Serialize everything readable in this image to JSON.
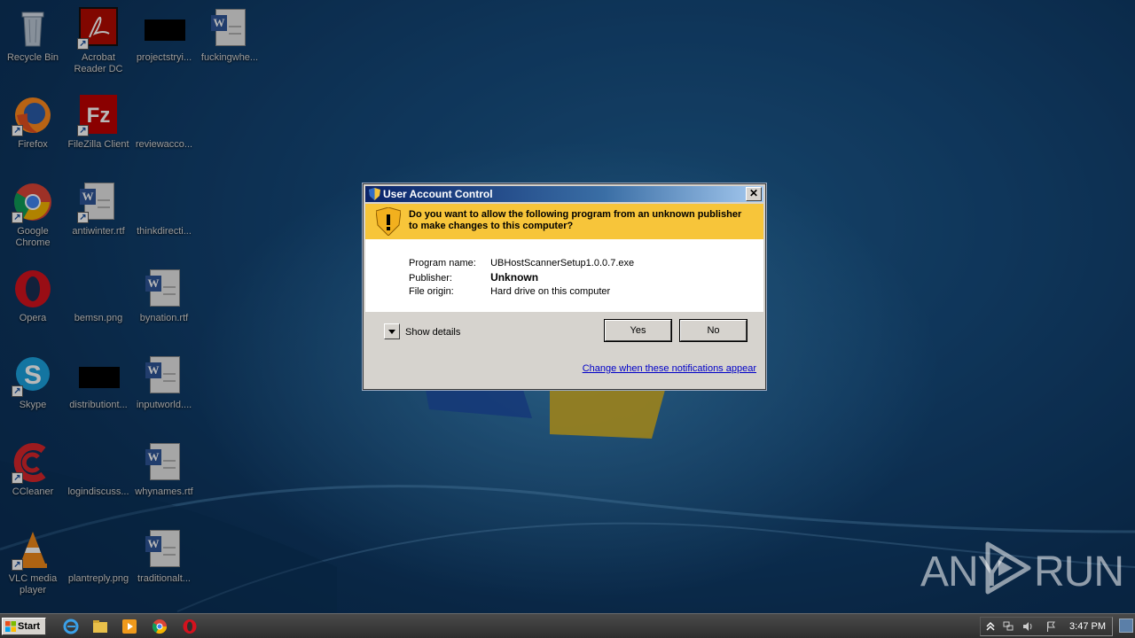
{
  "desktop": {
    "icons": [
      {
        "label": "Recycle Bin"
      },
      {
        "label": "Acrobat Reader DC"
      },
      {
        "label": "projectstryi..."
      },
      {
        "label": "fuckingwhe..."
      },
      {
        "label": "Firefox"
      },
      {
        "label": "FileZilla Client"
      },
      {
        "label": "reviewacco..."
      },
      {
        "label": "Google Chrome"
      },
      {
        "label": "antiwinter.rtf"
      },
      {
        "label": "thinkdirecti..."
      },
      {
        "label": "Opera"
      },
      {
        "label": "bemsn.png"
      },
      {
        "label": "bynation.rtf"
      },
      {
        "label": "Skype"
      },
      {
        "label": "distributiont..."
      },
      {
        "label": "inputworld...."
      },
      {
        "label": "CCleaner"
      },
      {
        "label": "logindiscuss..."
      },
      {
        "label": "whynames.rtf"
      },
      {
        "label": "VLC media player"
      },
      {
        "label": "plantreply.png"
      },
      {
        "label": "traditionalt..."
      }
    ]
  },
  "uac": {
    "title": "User Account Control",
    "close_glyph": "✕",
    "question": "Do you want to allow the following program from an unknown publisher to make changes to this computer?",
    "program_name_label": "Program name:",
    "program_name": "UBHostScannerSetup1.0.0.7.exe",
    "publisher_label": "Publisher:",
    "publisher": "Unknown",
    "file_origin_label": "File origin:",
    "file_origin": "Hard drive on this computer",
    "show_details": "Show details",
    "yes": "Yes",
    "no": "No",
    "change_link": "Change when these notifications appear",
    "banner_color": "#f7c53a"
  },
  "watermark": {
    "left": "ANY",
    "right": "RUN"
  },
  "taskbar": {
    "start": "Start",
    "clock": "3:47 PM",
    "pinned": [
      "internet-explorer-icon",
      "file-explorer-icon",
      "media-player-icon",
      "chrome-icon",
      "opera-icon"
    ]
  }
}
